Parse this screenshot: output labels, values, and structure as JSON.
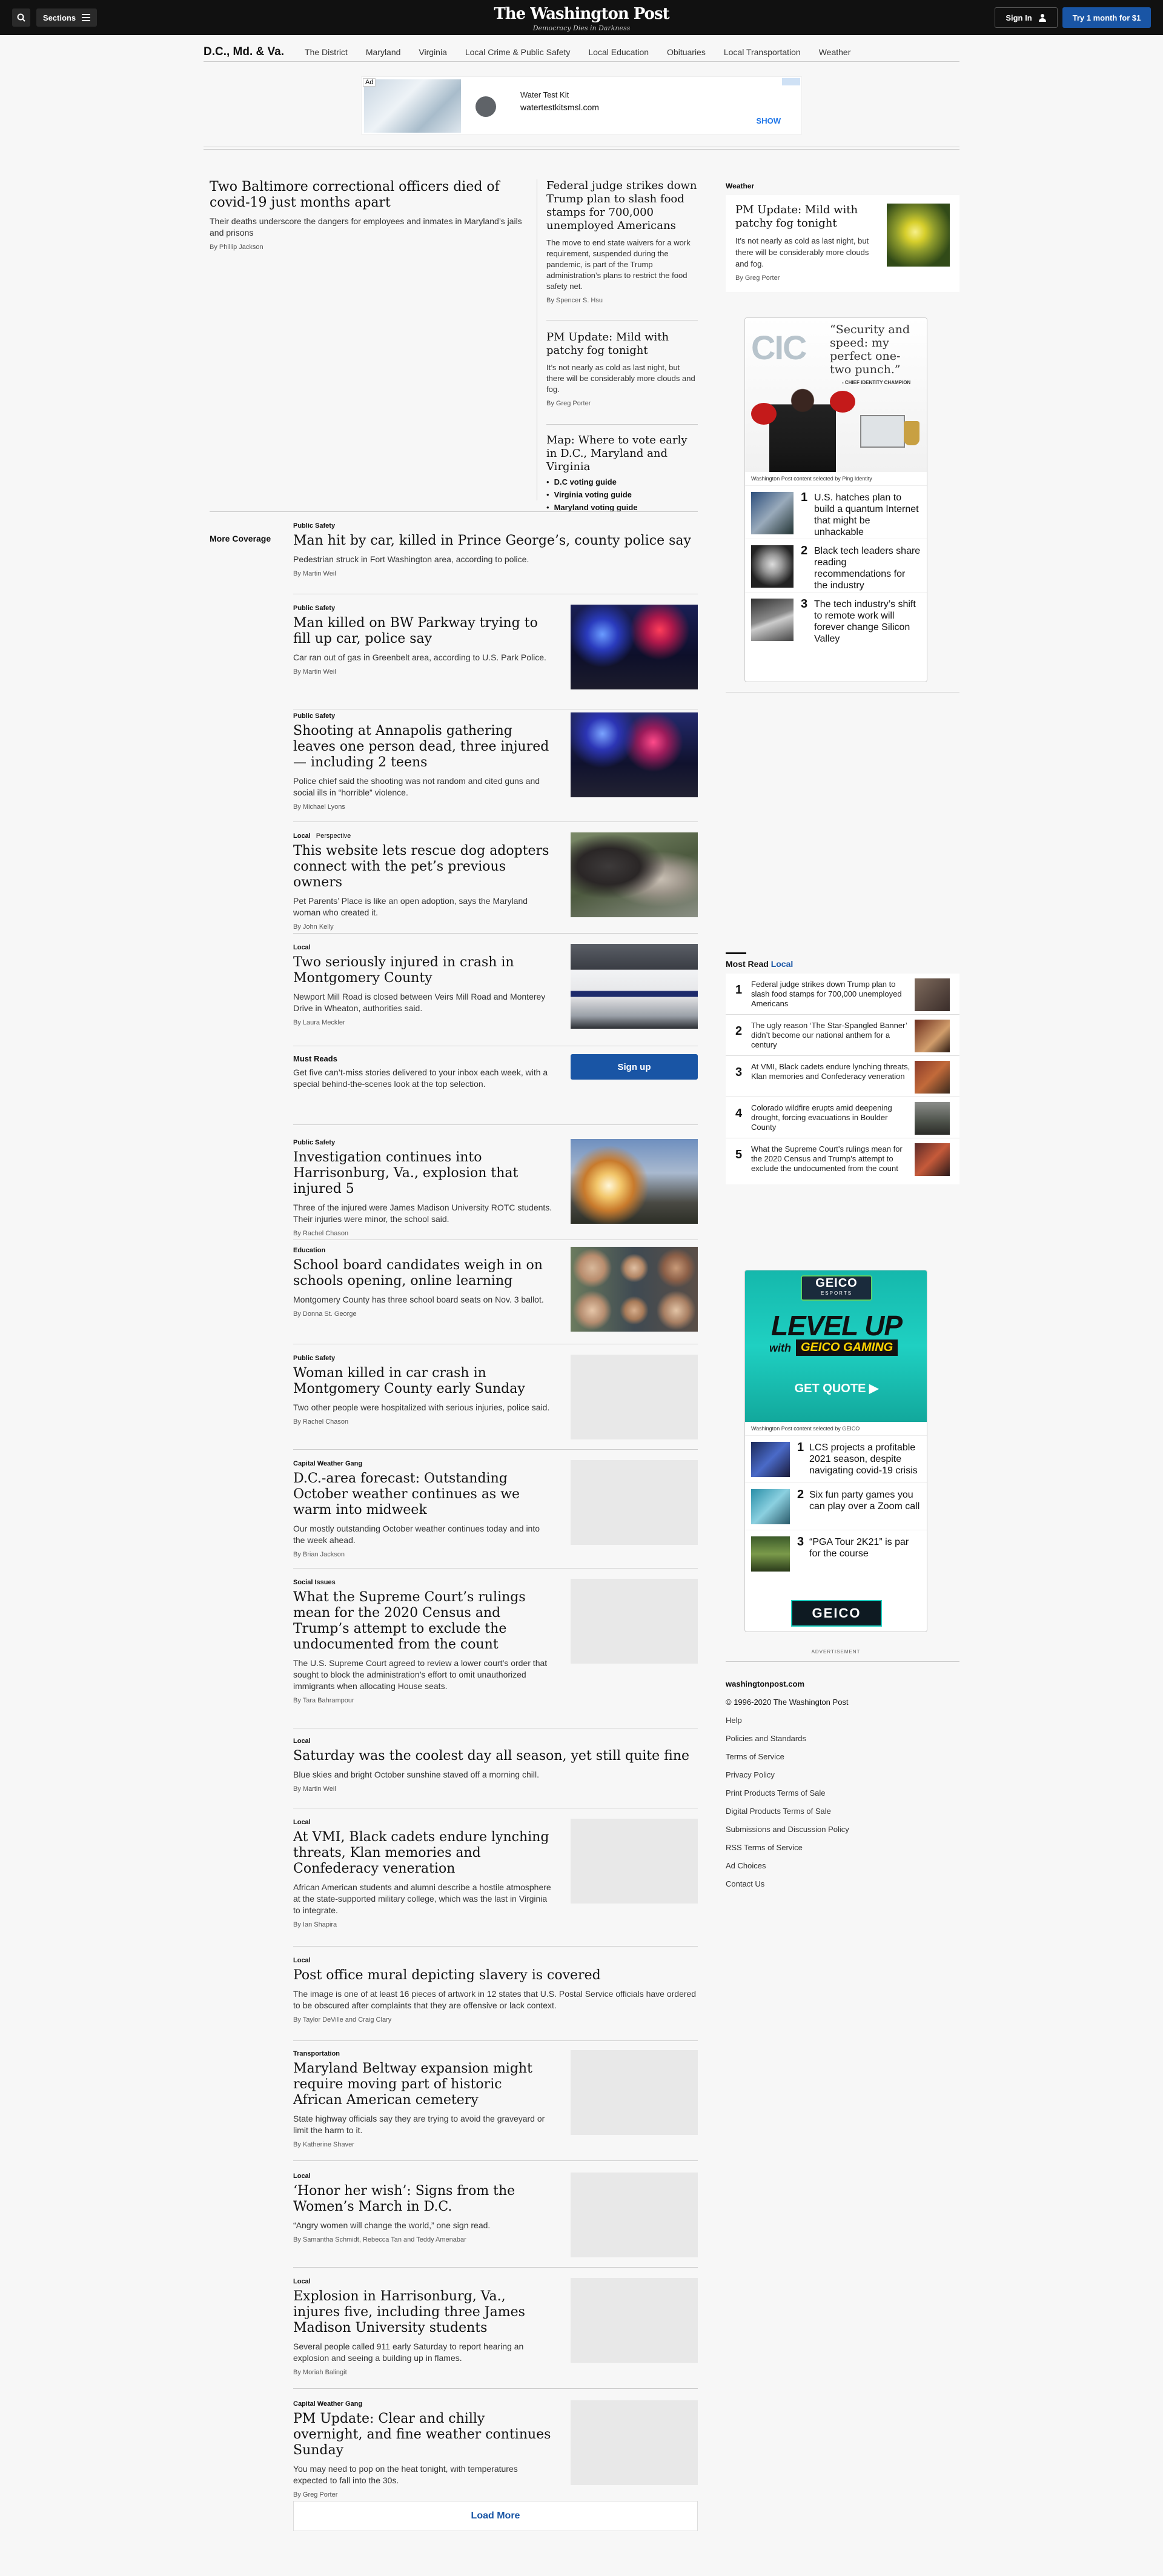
{
  "header": {
    "sections_label": "Sections",
    "logo": "The Washington Post",
    "tagline": "Democracy Dies in Darkness",
    "sign_in": "Sign In",
    "try_label": "Try 1 month for $1"
  },
  "nav": {
    "title": "D.C., Md. & Va.",
    "items": [
      "The District",
      "Maryland",
      "Virginia",
      "Local Crime & Public Safety",
      "Local Education",
      "Obituaries",
      "Local Transportation",
      "Weather"
    ]
  },
  "ad": {
    "tag": "Ad",
    "title": "Water Test Kit",
    "url": "watertestkitsmsl.com",
    "cta": "SHOW"
  },
  "lead": {
    "title": "Two Baltimore correctional officers died of covid-19 just months apart",
    "blurb": "Their deaths underscore the dangers for employees and inmates in Maryland’s jails and prisons",
    "by": "By",
    "author": "Phillip Jackson"
  },
  "top_stories": [
    {
      "title": "Federal judge strikes down Trump plan to slash food stamps for 700,000 unemployed Americans",
      "blurb": "The move to end state waivers for a work requirement, suspended during the pandemic, is part of the Trump administration’s plans to restrict the food safety net.",
      "author": "Spencer S. Hsu"
    },
    {
      "title": "PM Update: Mild with patchy fog tonight",
      "blurb": "It’s not nearly as cold as last night, but there will be considerably more clouds and fog.",
      "author": "Greg Porter"
    },
    {
      "title": "Map: Where to vote early in D.C., Maryland and Virginia",
      "bullets": [
        "D.C voting guide",
        "Virginia voting guide",
        "Maryland voting guide"
      ]
    }
  ],
  "more_coverage": "More Coverage",
  "feed": [
    {
      "kicker": "Public Safety",
      "title": "Man hit by car, killed in Prince George’s, county police say",
      "blurb": "Pedestrian struck in Fort Washington area, according to police.",
      "author": "Martin Weil"
    },
    {
      "kicker": "Public Safety",
      "title": "Man killed on BW Parkway trying to fill up car, police say",
      "blurb": "Car ran out of gas in Greenbelt area, according to U.S. Park Police.",
      "author": "Martin Weil"
    },
    {
      "kicker": "Public Safety",
      "title": "Shooting at Annapolis gathering leaves one person dead, three injured — including 2 teens",
      "blurb": "Police chief said the shooting was not random and cited guns and social ills in “horrible” violence.",
      "author": "Michael Lyons"
    },
    {
      "kicker": "Local",
      "kicker2": "Perspective",
      "title": "This website lets rescue dog adopters connect with the pet’s previous owners",
      "blurb": "Pet Parents’ Place is like an open adoption, says the Maryland woman who created it.",
      "author": "John Kelly"
    },
    {
      "kicker": "Local",
      "title": "Two seriously injured in crash in Montgomery County",
      "blurb": "Newport Mill Road is closed between Veirs Mill Road and Monterey Drive in Wheaton, authorities said.",
      "author": "Laura Meckler"
    },
    {
      "kicker": "Public Safety",
      "title": "Investigation continues into Harrisonburg, Va., explosion that injured 5",
      "blurb": "Three of the injured were James Madison University ROTC students. Their injuries were minor, the school said.",
      "author": "Rachel Chason"
    },
    {
      "kicker": "Education",
      "title": "School board candidates weigh in on schools opening, online learning",
      "blurb": "Montgomery County has three school board seats on Nov. 3 ballot.",
      "author": "Donna St. George"
    },
    {
      "kicker": "Public Safety",
      "title": "Woman killed in car crash in Montgomery County early Sunday",
      "blurb": "Two other people were hospitalized with serious injuries, police said.",
      "author": "Rachel Chason"
    },
    {
      "kicker": "Capital Weather Gang",
      "title": "D.C.-area forecast: Outstanding October weather continues as we warm into midweek",
      "blurb": "Our mostly outstanding October weather continues today and into the week ahead.",
      "author": "Brian Jackson"
    },
    {
      "kicker": "Social Issues",
      "title": "What the Supreme Court’s rulings mean for the 2020 Census and Trump’s attempt to exclude the undocumented from the count",
      "blurb": "The U.S. Supreme Court agreed to review a lower court’s order that sought to block the administration’s effort to omit unauthorized immigrants when allocating House seats.",
      "author": "Tara Bahrampour"
    },
    {
      "kicker": "Local",
      "title": "Saturday was the coolest day all season, yet still quite fine",
      "blurb": "Blue skies and bright October sunshine staved off a morning chill.",
      "author": "Martin Weil"
    },
    {
      "kicker": "Local",
      "title": "At VMI, Black cadets endure lynching threats, Klan memories and Confederacy veneration",
      "blurb": "African American students and alumni describe a hostile atmosphere at the state-supported military college, which was the last in Virginia to integrate.",
      "author": "Ian Shapira"
    },
    {
      "kicker": "Local",
      "title": "Post office mural depicting slavery is covered",
      "blurb": "The image is one of at least 16 pieces of artwork in 12 states that U.S. Postal Service officials have ordered to be obscured after complaints that they are offensive or lack context.",
      "author": "Taylor DeVille and Craig Clary"
    },
    {
      "kicker": "Transportation",
      "title": "Maryland Beltway expansion might require moving part of historic African American cemetery",
      "blurb": "State highway officials say they are trying to avoid the graveyard or limit the harm to it.",
      "author": "Katherine Shaver"
    },
    {
      "kicker": "Local",
      "title": "‘Honor her wish’: Signs from the Women’s March in D.C.",
      "blurb": "“Angry women will change the world,” one sign read.",
      "author": "Samantha Schmidt, Rebecca Tan and Teddy Amenabar"
    },
    {
      "kicker": "Local",
      "title": "Explosion in Harrisonburg, Va., injures five, including three James Madison University students",
      "blurb": "Several people called 911 early Saturday to report hearing an explosion and seeing a building up in flames.",
      "author": "Moriah Balingit"
    },
    {
      "kicker": "Capital Weather Gang",
      "title": "PM Update: Clear and chilly overnight, and fine weather continues Sunday",
      "blurb": "You may need to pop on the heat tonight, with temperatures expected to fall into the 30s.",
      "author": "Greg Porter"
    }
  ],
  "must_reads": {
    "title": "Must Reads",
    "blurb": "Get five can’t-miss stories delivered to your inbox each week, with a special behind-the-scenes look at the top selection.",
    "button": "Sign up"
  },
  "load_more": "Load More",
  "sidebar": {
    "weather_label": "Weather",
    "weather": {
      "title": "PM Update: Mild with patchy fog tonight",
      "blurb": "It’s not nearly as cold as last night, but there will be considerably more clouds and fog.",
      "author": "Greg Porter"
    },
    "ad1": {
      "quote": "“Security and speed: my perfect one-two punch.”",
      "attrib": "- CHIEF IDENTITY CHAMPION",
      "logo": "CIC",
      "sub": "Washington Post content selected by Ping Identity",
      "items": [
        "U.S. hatches plan to build a quantum Internet that might be unhackable",
        "Black tech leaders share reading recommendations for the industry",
        "The tech industry’s shift to remote work will forever change Silicon Valley"
      ]
    },
    "most_read_label": "Most Read",
    "most_read_section": "Local",
    "most_read": [
      "Federal judge strikes down Trump plan to slash food stamps for 700,000 unemployed Americans",
      "The ugly reason ‘The Star-Spangled Banner’ didn’t become our national anthem for a century",
      "At VMI, Black cadets endure lynching threats, Klan memories and Confederacy veneration",
      "Colorado wildfire erupts amid deepening drought, forcing evacuations in Boulder County",
      "What the Supreme Court’s rulings mean for the 2020 Census and Trump’s attempt to exclude the undocumented from the count"
    ],
    "ad2": {
      "brand": "GEICO",
      "sub_brand": "ESPORTS",
      "headline": "LEVEL UP",
      "with": "with",
      "gaming": "GEICO GAMING",
      "cta": "GET QUOTE ▶",
      "sub": "Washington Post content selected by GEICO",
      "items": [
        "LCS projects a profitable 2021 season, despite navigating covid-19 crisis",
        "Six fun party games you can play over a Zoom call",
        "“PGA Tour 2K21” is par for the course"
      ],
      "footer_logo": "GEICO"
    },
    "advert_label": "ADVERTISEMENT",
    "footer": {
      "site": "washingtonpost.com",
      "copyright": "© 1996-2020 The Washington Post",
      "links": [
        "Help",
        "Policies and Standards",
        "Terms of Service",
        "Privacy Policy",
        "Print Products Terms of Sale",
        "Digital Products Terms of Sale",
        "Submissions and Discussion Policy",
        "RSS Terms of Service",
        "Ad Choices",
        "Contact Us"
      ]
    }
  },
  "colors": {
    "brand_blue": "#1955a5",
    "topbar": "#111111",
    "geico_teal": "#19c3b6"
  }
}
